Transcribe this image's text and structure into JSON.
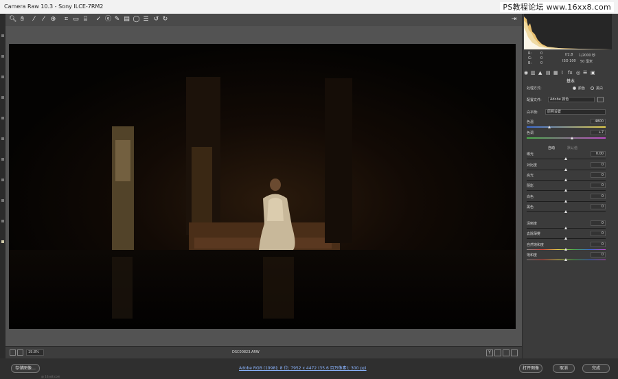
{
  "window": {
    "title": "Camera Raw 10.3  -  Sony ILCE-7RM2"
  },
  "watermark": "PS教程论坛 www.16xx8.com",
  "toolbar": {
    "tools": [
      {
        "name": "zoom-tool",
        "icon": "zoom-icon",
        "glyph": "🔍︎"
      },
      {
        "name": "hand-tool",
        "icon": "hand-icon",
        "glyph": "✋︎"
      },
      {
        "name": "white-balance-tool",
        "icon": "eyedropper-icon",
        "glyph": "⁄"
      },
      {
        "name": "color-sampler-tool",
        "icon": "color-sampler-icon",
        "glyph": "⁄"
      },
      {
        "name": "targeted-adjustment-tool",
        "icon": "target-adjust-icon",
        "glyph": "⊕"
      },
      {
        "name": "crop-tool",
        "icon": "crop-icon",
        "glyph": "⌗"
      },
      {
        "name": "straighten-tool",
        "icon": "straighten-icon",
        "glyph": "▭"
      },
      {
        "name": "transform-tool",
        "icon": "transform-icon",
        "glyph": "⌸"
      },
      {
        "name": "spot-removal-tool",
        "icon": "brush-icon",
        "glyph": "✓"
      },
      {
        "name": "red-eye-tool",
        "icon": "red-eye-icon",
        "glyph": "ⓞ"
      },
      {
        "name": "adjustment-brush-tool",
        "icon": "adjustment-brush-icon",
        "glyph": "✎"
      },
      {
        "name": "graduated-filter-tool",
        "icon": "graduated-filter-icon",
        "glyph": "▤"
      },
      {
        "name": "radial-filter-tool",
        "icon": "radial-filter-icon",
        "glyph": "◯"
      },
      {
        "name": "preferences-tool",
        "icon": "preferences-icon",
        "glyph": "☰"
      },
      {
        "name": "rotate-left-tool",
        "icon": "rotate-left-icon",
        "glyph": "↺"
      },
      {
        "name": "rotate-right-tool",
        "icon": "rotate-right-icon",
        "glyph": "↻"
      }
    ],
    "export_glyph": "⇥"
  },
  "canvas": {
    "zoom": "19.8%",
    "filename": "DSC00823.ARW",
    "compare_label": "Y"
  },
  "histogram": {
    "readout": {
      "r_label": "R:",
      "r_val": "0",
      "g_label": "G:",
      "g_val": "0",
      "b_label": "B:",
      "b_val": "0",
      "aperture": "f/2.8",
      "shutter": "1/2000 秒",
      "iso": "ISO 100",
      "lens": "50 毫米"
    }
  },
  "panel": {
    "tabs": [
      "◉",
      "▥",
      "▲",
      "▤",
      "▦",
      "⌇",
      "fx",
      "◎",
      "☰",
      "▣"
    ],
    "title": "基本",
    "treatment_label": "处理方式:",
    "treatment_color": "颜色",
    "treatment_bw": "黑白",
    "profile_label": "配置文件:",
    "profile_value": "Adobe 颜色",
    "wb_label": "白平衡:",
    "wb_value": "原照设置",
    "temp_label": "色温",
    "temp_value": "4800",
    "tint_label": "色调",
    "tint_value": "+7",
    "auto_label": "自动",
    "default_label": "默认值",
    "sliders": [
      {
        "name": "exposure",
        "label": "曝光",
        "value": "0.00"
      },
      {
        "name": "contrast",
        "label": "对比度",
        "value": "0"
      },
      {
        "name": "highlights",
        "label": "高光",
        "value": "0"
      },
      {
        "name": "shadows",
        "label": "阴影",
        "value": "0"
      },
      {
        "name": "whites",
        "label": "白色",
        "value": "0"
      },
      {
        "name": "blacks",
        "label": "黑色",
        "value": "0"
      }
    ],
    "presence": [
      {
        "name": "clarity",
        "label": "清晰度",
        "value": "0"
      },
      {
        "name": "dehaze",
        "label": "去除薄雾",
        "value": "0"
      },
      {
        "name": "vibrance",
        "label": "自然饱和度",
        "value": "0"
      },
      {
        "name": "saturation",
        "label": "饱和度",
        "value": "0"
      }
    ]
  },
  "bottom": {
    "save_button": "存储图像...",
    "workflow_link": "Adobe RGB (1998); 8 位; 7952 x 4472 (35.6 百万像素); 300 ppi",
    "open_button": "打开图像",
    "cancel_button": "取消",
    "done_button": "完成",
    "tiny_text": "@ 16xx8.com"
  },
  "colors": {
    "accent": "#8ab4ff",
    "panel_bg": "#3b3b3b",
    "canvas_bg": "#535353"
  }
}
